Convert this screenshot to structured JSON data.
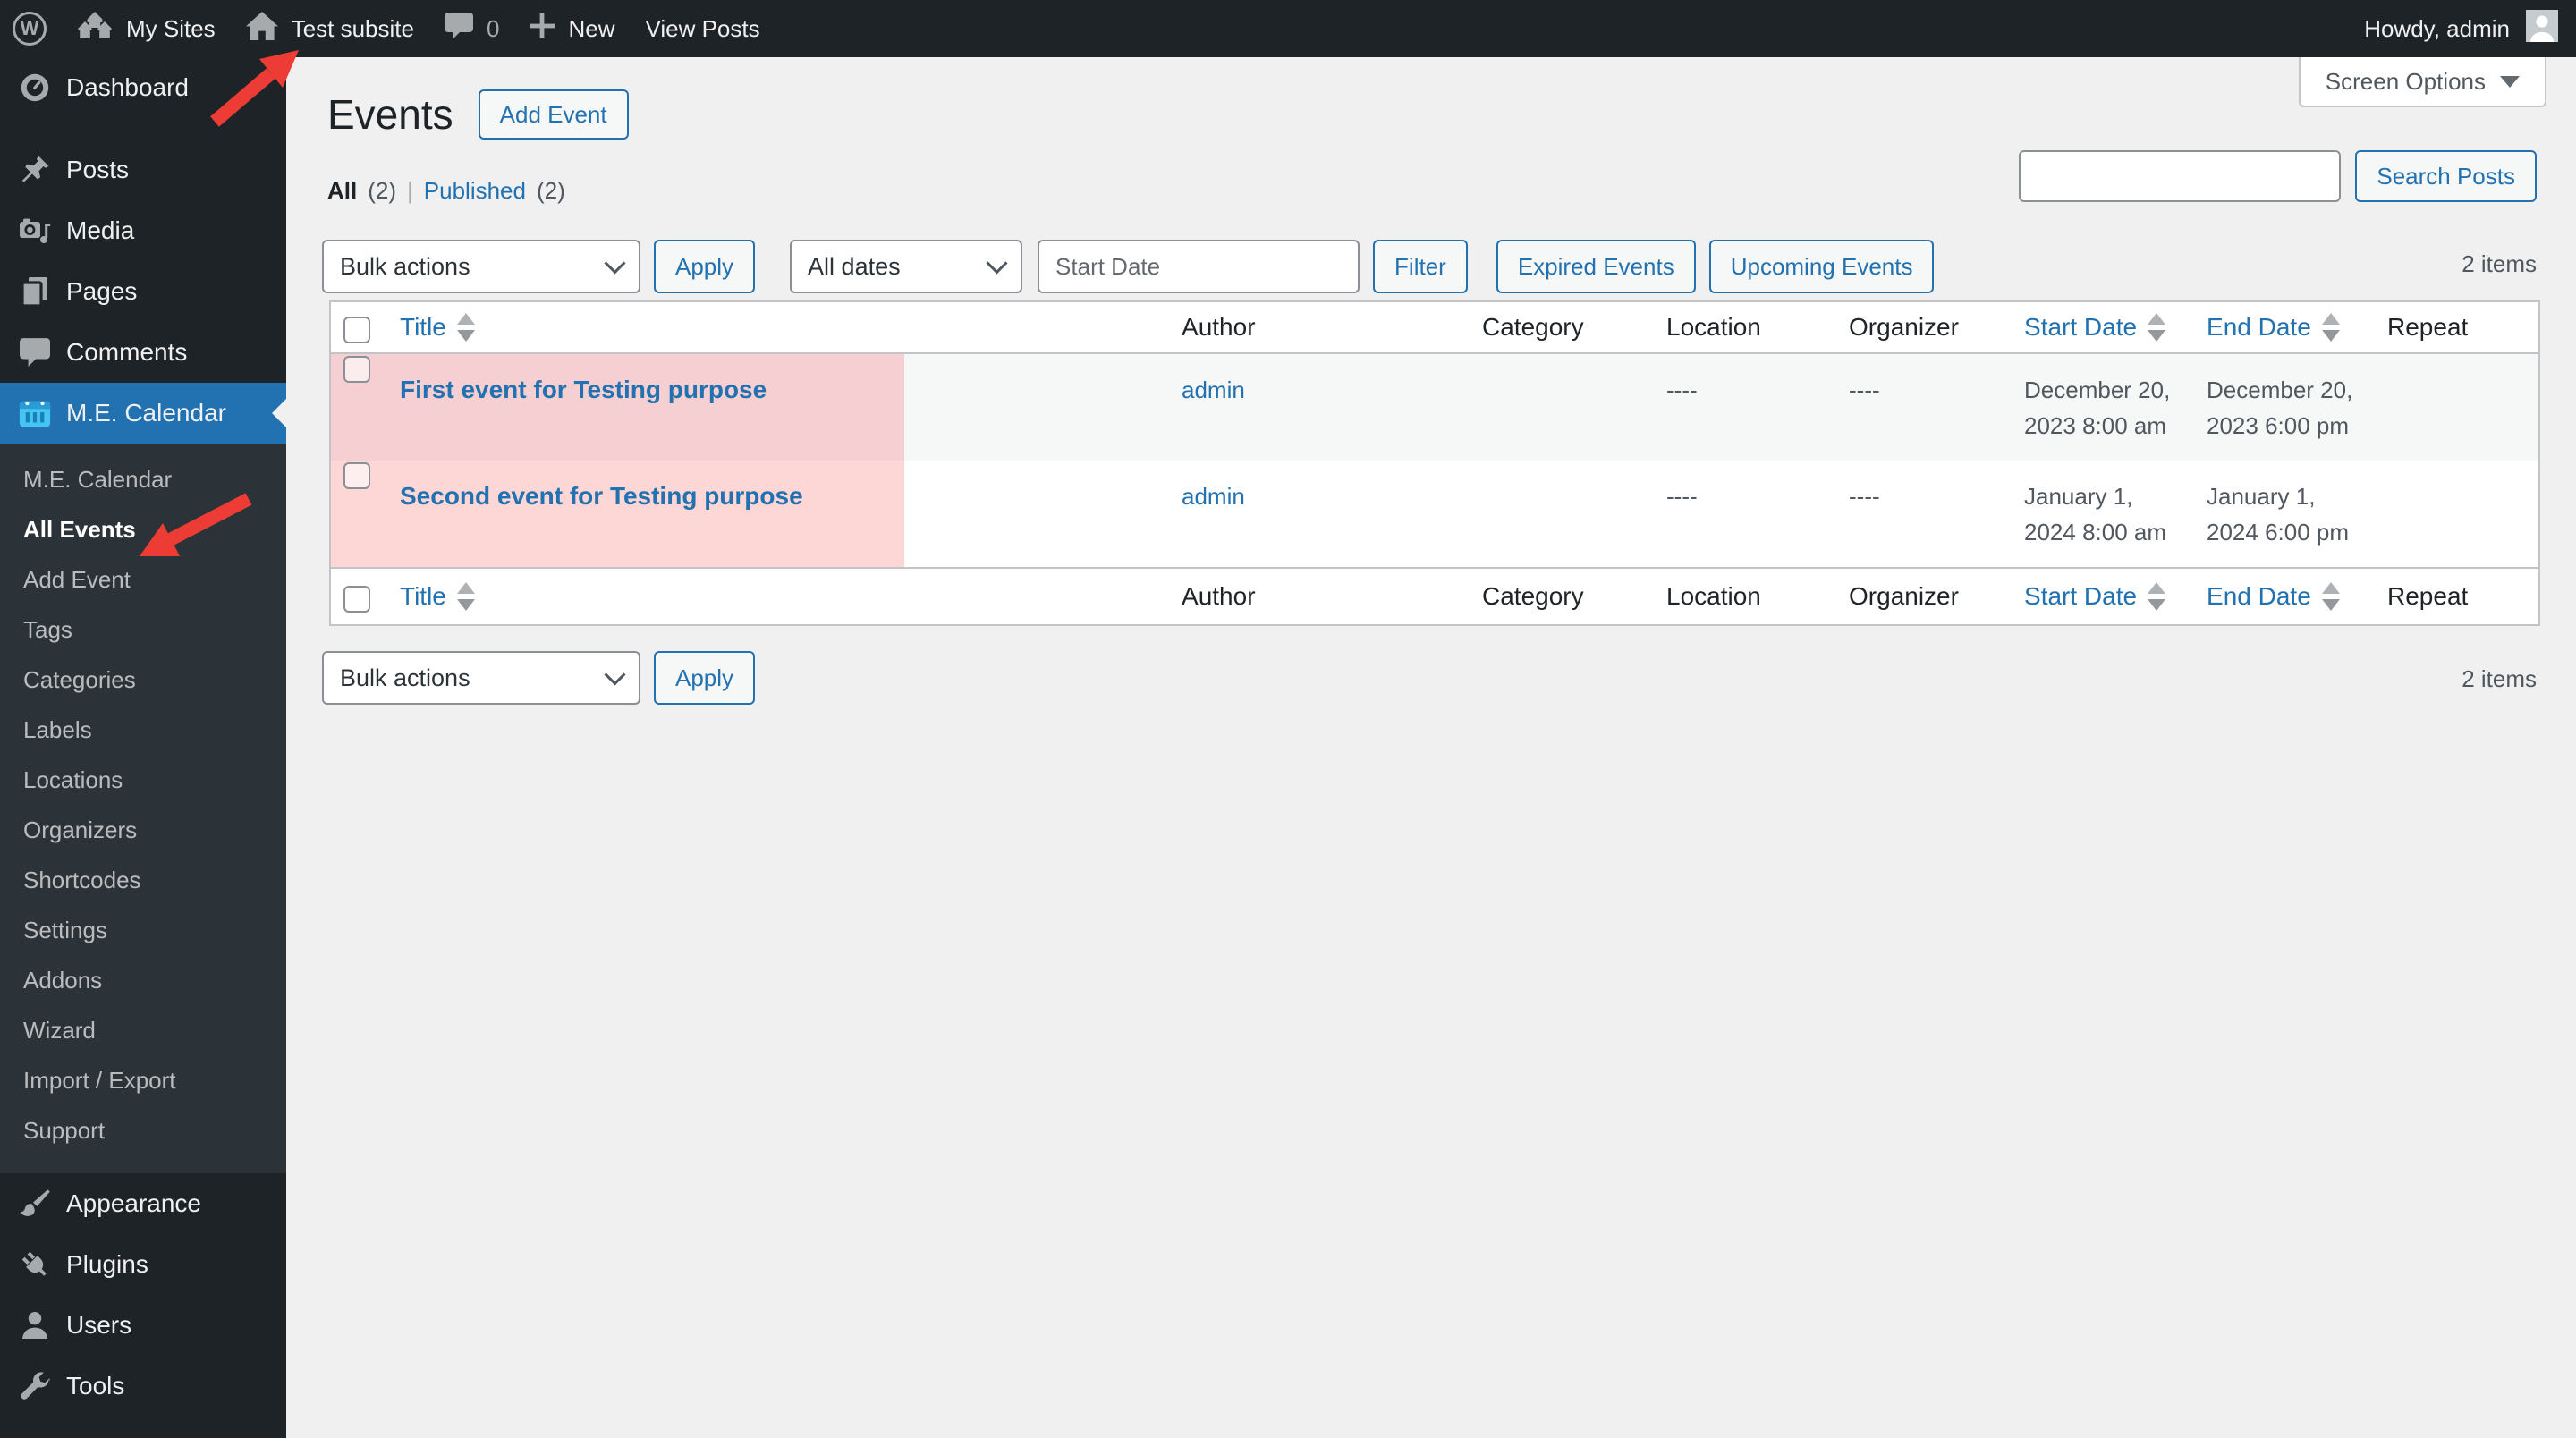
{
  "admin_bar": {
    "wordpress_logo": "W",
    "my_sites": "My Sites",
    "site_name": "Test subsite",
    "comments_count": "0",
    "new_label": "New",
    "view_posts": "View Posts",
    "howdy": "Howdy, admin"
  },
  "screen_options": {
    "label": "Screen Options"
  },
  "sidebar": {
    "top": [
      {
        "label": "Dashboard",
        "icon": "dashboard"
      },
      {
        "label": "Posts",
        "icon": "pushpin"
      },
      {
        "label": "Media",
        "icon": "camera"
      },
      {
        "label": "Pages",
        "icon": "pages"
      },
      {
        "label": "Comments",
        "icon": "comment"
      },
      {
        "label": "M.E. Calendar",
        "icon": "calendar",
        "active": true
      }
    ],
    "submenu": [
      {
        "label": "M.E. Calendar"
      },
      {
        "label": "All Events",
        "current": true
      },
      {
        "label": "Add Event"
      },
      {
        "label": "Tags"
      },
      {
        "label": "Categories"
      },
      {
        "label": "Labels"
      },
      {
        "label": "Locations"
      },
      {
        "label": "Organizers"
      },
      {
        "label": "Shortcodes"
      },
      {
        "label": "Settings"
      },
      {
        "label": "Addons"
      },
      {
        "label": "Wizard"
      },
      {
        "label": "Import / Export"
      },
      {
        "label": "Support"
      }
    ],
    "bottom": [
      {
        "label": "Appearance",
        "icon": "brush"
      },
      {
        "label": "Plugins",
        "icon": "plug"
      },
      {
        "label": "Users",
        "icon": "user"
      },
      {
        "label": "Tools",
        "icon": "wrench"
      }
    ]
  },
  "page": {
    "title": "Events",
    "add_event_label": "Add Event",
    "views": {
      "all_label": "All",
      "all_count": "(2)",
      "separator": "|",
      "published_label": "Published",
      "published_count": "(2)"
    },
    "filters": {
      "bulk_actions": "Bulk actions",
      "apply": "Apply",
      "all_dates": "All dates",
      "start_date_placeholder": "Start Date",
      "filter": "Filter",
      "expired_events": "Expired Events",
      "upcoming_events": "Upcoming Events"
    },
    "search": {
      "value": "",
      "button": "Search Posts"
    },
    "items_count": "2 items",
    "table": {
      "columns": [
        "Title",
        "Author",
        "Category",
        "Location",
        "Organizer",
        "Start Date",
        "End Date",
        "Repeat"
      ],
      "rows": [
        {
          "title": "First event for Testing purpose",
          "author": "admin",
          "category": "",
          "location": "----",
          "organizer": "----",
          "start_date": "December 20, 2023 8:00 am",
          "end_date": "December 20, 2023 6:00 pm",
          "repeat": ""
        },
        {
          "title": "Second event for Testing purpose",
          "author": "admin",
          "category": "",
          "location": "----",
          "organizer": "----",
          "start_date": "January 1, 2024 8:00 am",
          "end_date": "January 1, 2024 6:00 pm",
          "repeat": ""
        }
      ]
    },
    "bottom": {
      "bulk_actions": "Bulk actions",
      "apply": "Apply",
      "items_count": "2 items"
    }
  },
  "colors": {
    "accent_blue": "#2271b1",
    "admin_bar_bg": "#1d2327",
    "sidebar_bg": "#1d2327",
    "submenu_bg": "#2c3338",
    "page_bg": "#f0f0f1",
    "table_border": "#c3c4c7",
    "input_border": "#8c8f94",
    "row_alt_bg": "#f6f7f7",
    "expired_row_pink_alt": "#f5cfd1",
    "expired_row_pink": "#fdd6d6",
    "annotation_arrow_red": "#ed3c36",
    "icon_gray": "#a7aaad"
  }
}
